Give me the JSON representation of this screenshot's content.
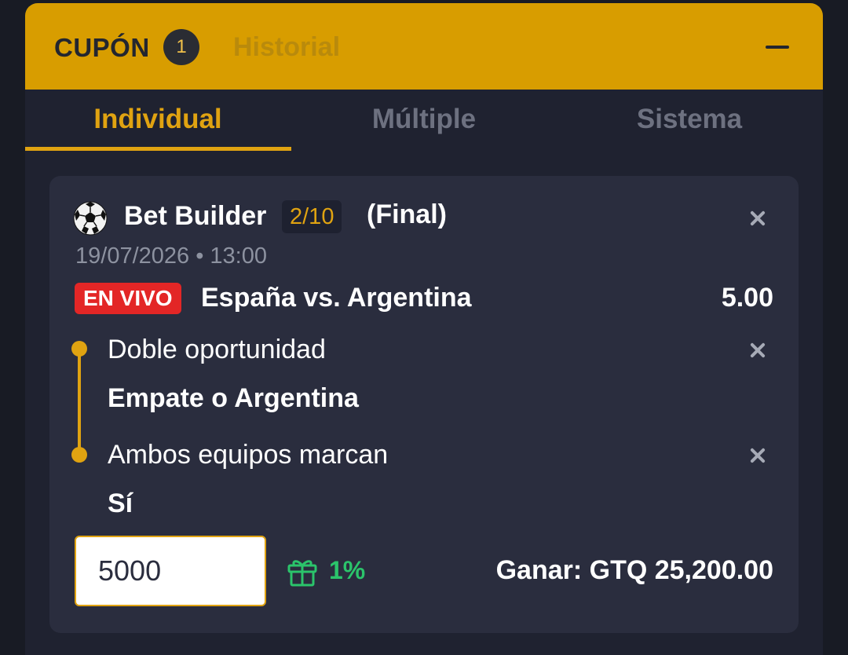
{
  "header": {
    "title": "CUPÓN",
    "badge_count": "1",
    "history_tab": "Historial"
  },
  "tabs": [
    {
      "label": "Individual",
      "active": true
    },
    {
      "label": "Múltiple",
      "active": false
    },
    {
      "label": "Sistema",
      "active": false
    }
  ],
  "bet": {
    "icon": "soccer-ball-icon",
    "title": "Bet Builder",
    "count": "2/10",
    "stage": "(Final)",
    "datetime": "19/07/2026 • 13:00",
    "live_label": "EN VIVO",
    "match": "España vs. Argentina",
    "odds": "5.00",
    "selections": [
      {
        "market": "Doble oportunidad",
        "pick": "Empate o Argentina"
      },
      {
        "market": "Ambos equipos marcan",
        "pick": "Sí"
      }
    ]
  },
  "stake": {
    "value": "5000",
    "bonus_icon": "gift-icon",
    "bonus": "1%",
    "win_label": "Ganar: GTQ 25,200.00"
  },
  "colors": {
    "accent": "#e0a311",
    "header_bg": "#d89d00",
    "panel_bg": "#1f2230",
    "card_bg": "#2a2d3e",
    "live": "#e32626",
    "bonus": "#2bc46b"
  }
}
